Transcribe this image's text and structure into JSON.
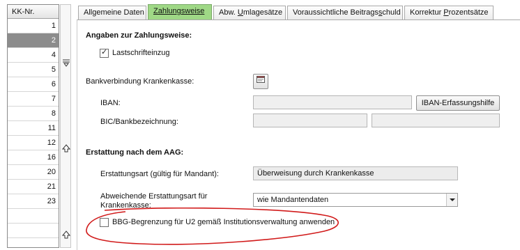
{
  "kk_list": {
    "header": "KK-Nr.",
    "rows": [
      "1",
      "2",
      "4",
      "5",
      "6",
      "7",
      "8",
      "11",
      "12",
      "16",
      "20",
      "21",
      "23",
      "",
      "",
      ""
    ],
    "selected_index": 1
  },
  "tabs": [
    {
      "label_pre": "Allgemeine Daten",
      "label_u": "",
      "label_post": ""
    },
    {
      "label_pre": "",
      "label_u": "Zahlungsweise",
      "label_post": ""
    },
    {
      "label_pre": "Abw. ",
      "label_u": "U",
      "label_post": "mlagesätze"
    },
    {
      "label_pre": "Voraussichtliche Beitrags",
      "label_u": "s",
      "label_post": "chuld"
    },
    {
      "label_pre": "Korrektur ",
      "label_u": "P",
      "label_post": "rozentsätze"
    }
  ],
  "zahlungsweise": {
    "title": "Angaben zur Zahlungsweise:",
    "lastschrift_label": "Lastschrifteinzug",
    "lastschrift_checked": true
  },
  "bank": {
    "label": "Bankverbindung Krankenkasse:",
    "iban_label": "IBAN:",
    "iban_value": "",
    "iban_button": "IBAN-Erfassungshilfe",
    "bic_label": "BIC/Bankbezeichnung:",
    "bic_value": "",
    "bankname_value": ""
  },
  "aag": {
    "title": "Erstattung nach dem AAG:",
    "erstattungsart_label": "Erstattungsart (gültig für Mandant):",
    "erstattungsart_value": "Überweisung durch Krankenkasse",
    "abweichend_label_1": "Abweichende Erstattungsart für",
    "abweichend_label_2": "Krankenkasse:",
    "abweichend_value": "wie Mandantendaten",
    "bbg_label": "BBG-Begrenzung für U2 gemäß Institutionsverwaltung anwenden",
    "bbg_checked": false
  },
  "colors": {
    "active_tab": "#9fd886",
    "selected_row": "#8c8c8c",
    "annotation": "#d11a1a"
  }
}
